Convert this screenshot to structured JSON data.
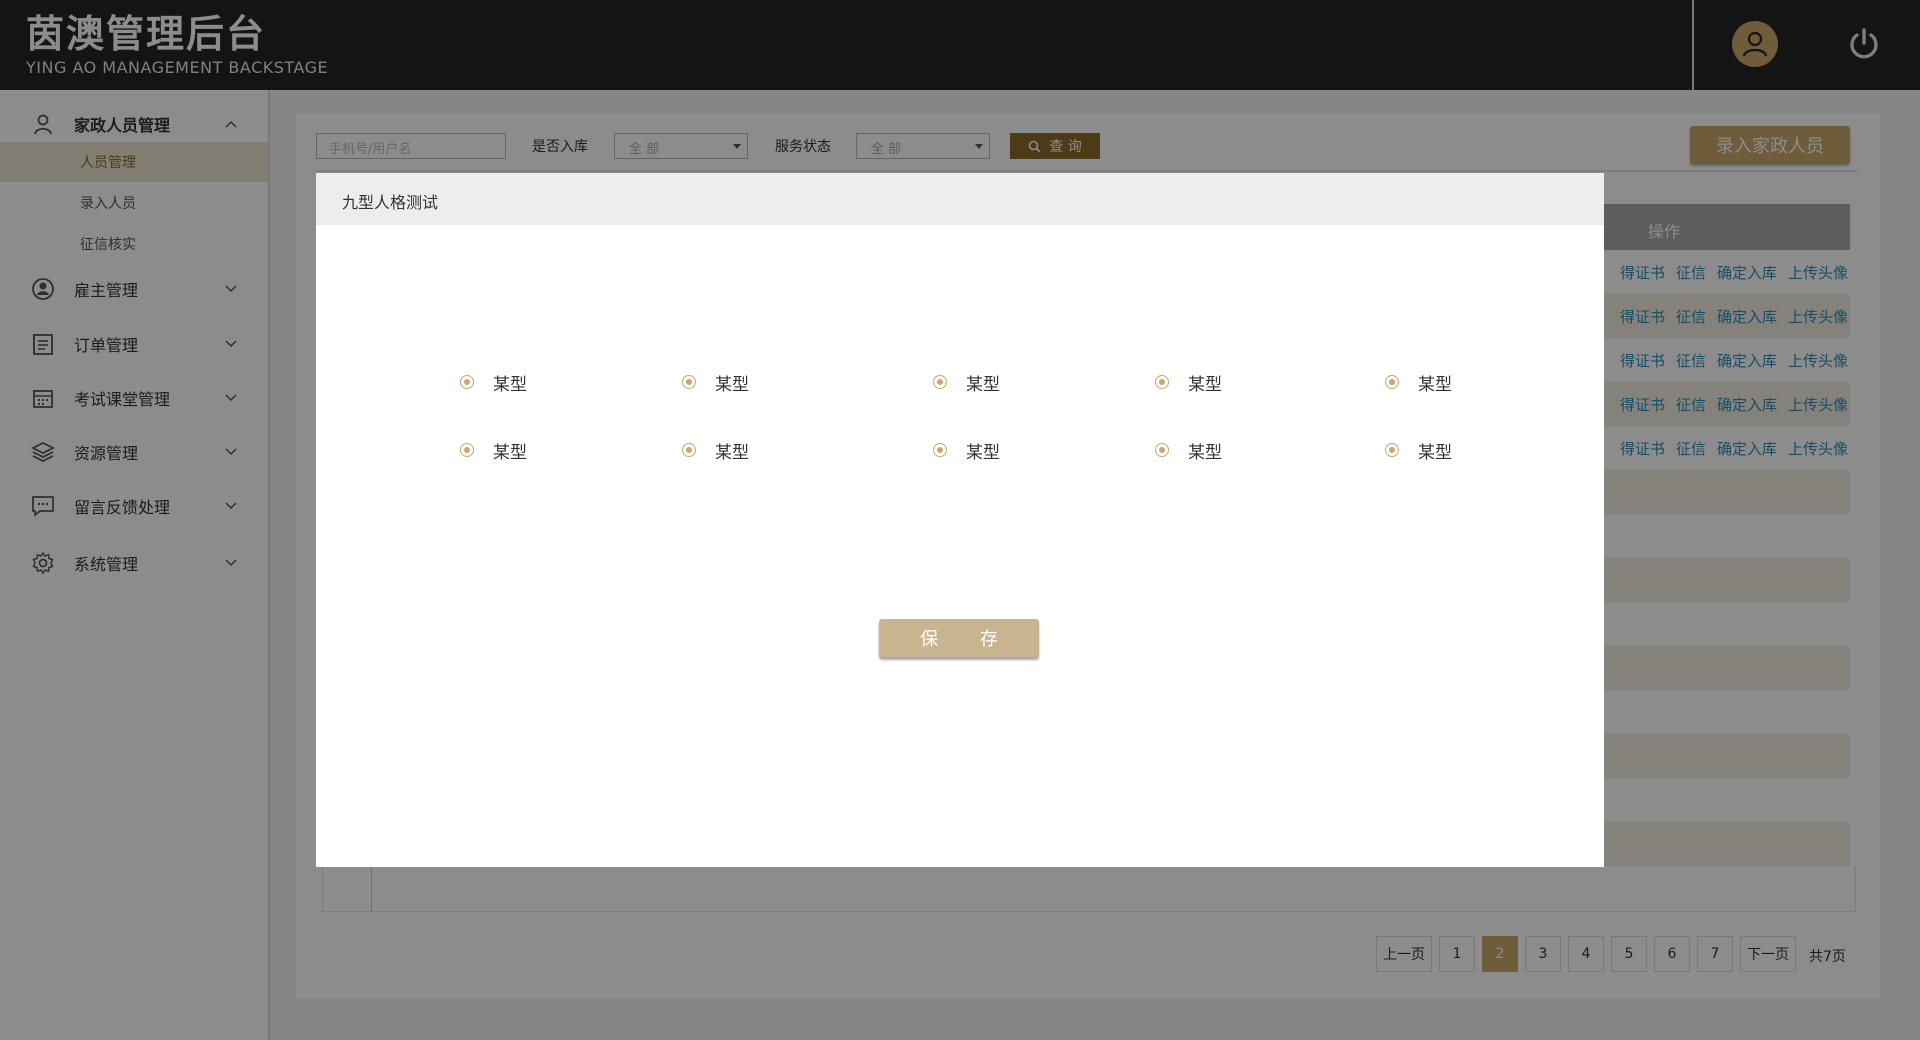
{
  "header": {
    "brand_title": "茵澳管理后台",
    "brand_subtitle": "YING AO MANAGEMENT BACKSTAGE",
    "avatar_icon": "user-icon",
    "logout_icon": "power-icon"
  },
  "sidebar": {
    "groups": [
      {
        "label": "家政人员管理",
        "icon": "worker-icon",
        "expanded": true,
        "items": [
          {
            "label": "人员管理",
            "active": true
          },
          {
            "label": "录入人员",
            "active": false
          },
          {
            "label": "征信核实",
            "active": false
          }
        ]
      },
      {
        "label": "雇主管理",
        "icon": "employer-icon",
        "expanded": false
      },
      {
        "label": "订单管理",
        "icon": "order-icon",
        "expanded": false
      },
      {
        "label": "考试课堂管理",
        "icon": "calendar-icon",
        "expanded": false
      },
      {
        "label": "资源管理",
        "icon": "layers-icon",
        "expanded": false
      },
      {
        "label": "留言反馈处理",
        "icon": "message-icon",
        "expanded": false
      },
      {
        "label": "系统管理",
        "icon": "gear-icon",
        "expanded": false
      }
    ]
  },
  "filters": {
    "search_placeholder": "手机号/用户名",
    "in_library_label": "是否入库",
    "in_library_value": "全 部",
    "service_status_label": "服务状态",
    "service_status_value": "全 部",
    "query_button": "查 询",
    "add_button": "录入家政人员"
  },
  "table": {
    "operation_header": "操作",
    "row_actions": [
      "得证书",
      "征信",
      "确定入库",
      "上传头像"
    ]
  },
  "pagination": {
    "prev": "上一页",
    "pages": [
      "1",
      "2",
      "3",
      "4",
      "5",
      "6",
      "7"
    ],
    "current": "2",
    "next": "下一页",
    "total": "共7页"
  },
  "modal": {
    "title": "九型人格测试",
    "options_row1": [
      "某型",
      "某型",
      "某型",
      "某型",
      "某型"
    ],
    "options_row2": [
      "某型",
      "某型",
      "某型",
      "某型",
      "某型"
    ],
    "save_button": "保 存"
  },
  "colors": {
    "header_bg": "#262626",
    "accent_gold": "#c8a86a",
    "accent_brown": "#8a6a2c",
    "link_blue": "#2b8fb8"
  }
}
